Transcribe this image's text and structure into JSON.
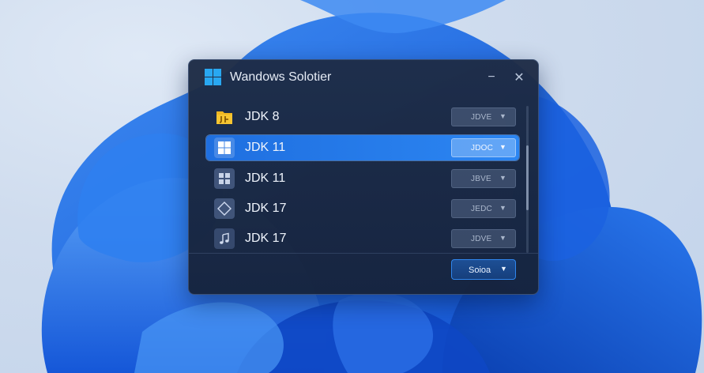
{
  "window": {
    "title": "Wandows Solotier",
    "app_icon": "windows-logo-icon",
    "minimize_glyph": "−",
    "close_glyph": "✕"
  },
  "jdk_list": [
    {
      "label": "JDK 8",
      "select_value": "JDVE",
      "icon": "java-folder-icon",
      "selected": false
    },
    {
      "label": "JDK 11",
      "select_value": "JDOC",
      "icon": "windows-logo-icon",
      "selected": true
    },
    {
      "label": "JDK 11",
      "select_value": "JBVE",
      "icon": "grid-app-icon",
      "selected": false
    },
    {
      "label": "JDK 17",
      "select_value": "JEDC",
      "icon": "diamond-icon",
      "selected": false
    },
    {
      "label": "JDK 17",
      "select_value": "JDVE",
      "icon": "music-note-icon",
      "selected": false
    }
  ],
  "footer": {
    "button_label": "Soioa"
  },
  "colors": {
    "accent": "#2c86f2",
    "window_bg": "#1e2c46",
    "java_yellow": "#f0b722"
  }
}
